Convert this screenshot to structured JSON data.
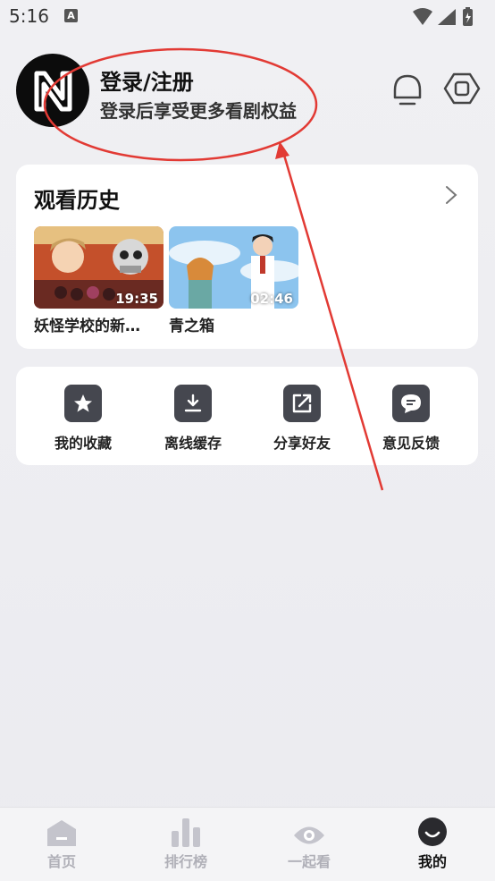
{
  "status_bar": {
    "time": "5:16",
    "notification_letter": "A"
  },
  "profile": {
    "title": "登录/注册",
    "subtitle": "登录后享受更多看剧权益",
    "avatar_letter": "N"
  },
  "header_icons": [
    "bell-icon",
    "settings-icon"
  ],
  "history": {
    "title": "观看历史",
    "items": [
      {
        "title": "妖怪学校的新…",
        "duration": "19:35"
      },
      {
        "title": "青之箱",
        "duration": "02:46"
      }
    ]
  },
  "actions": [
    {
      "label": "我的收藏",
      "icon": "star-icon"
    },
    {
      "label": "离线缓存",
      "icon": "download-icon"
    },
    {
      "label": "分享好友",
      "icon": "share-icon"
    },
    {
      "label": "意见反馈",
      "icon": "feedback-icon"
    }
  ],
  "bottom_nav": [
    {
      "label": "首页",
      "icon": "home-icon",
      "active": false
    },
    {
      "label": "排行榜",
      "icon": "ranking-icon",
      "active": false
    },
    {
      "label": "一起看",
      "icon": "eye-icon",
      "active": false
    },
    {
      "label": "我的",
      "icon": "profile-icon",
      "active": true
    }
  ],
  "colors": {
    "annotation": "#e23a34",
    "icon_dark": "#45474f",
    "nav_inactive": "#b0b0b8"
  }
}
